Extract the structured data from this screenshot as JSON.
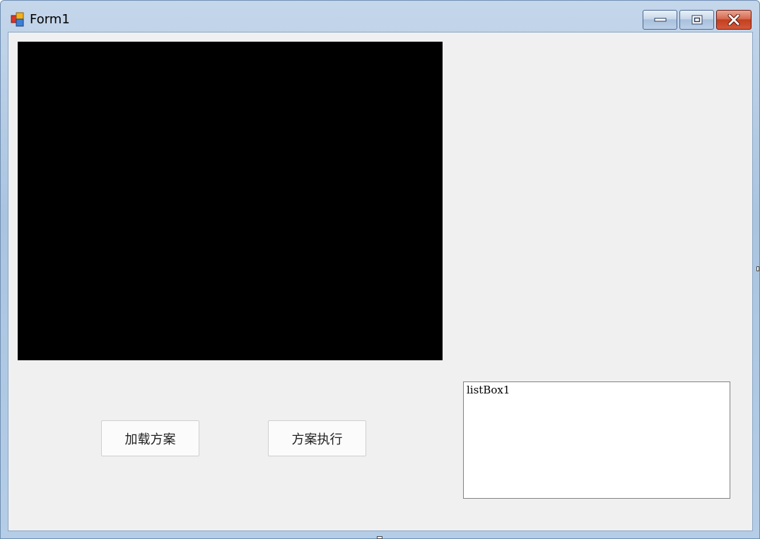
{
  "window": {
    "title": "Form1",
    "icon": "winforms-app-icon",
    "caption_buttons": {
      "minimize_icon": "minimize-icon",
      "maximize_icon": "maximize-icon",
      "close_icon": "close-icon"
    },
    "colors": {
      "client_background": "#f0f0f0",
      "picture_background": "#000000",
      "close_button": "#c2401f"
    }
  },
  "form": {
    "load_button_label": "加载方案",
    "execute_button_label": "方案执行",
    "listbox": {
      "items": [
        "listBox1"
      ]
    }
  }
}
